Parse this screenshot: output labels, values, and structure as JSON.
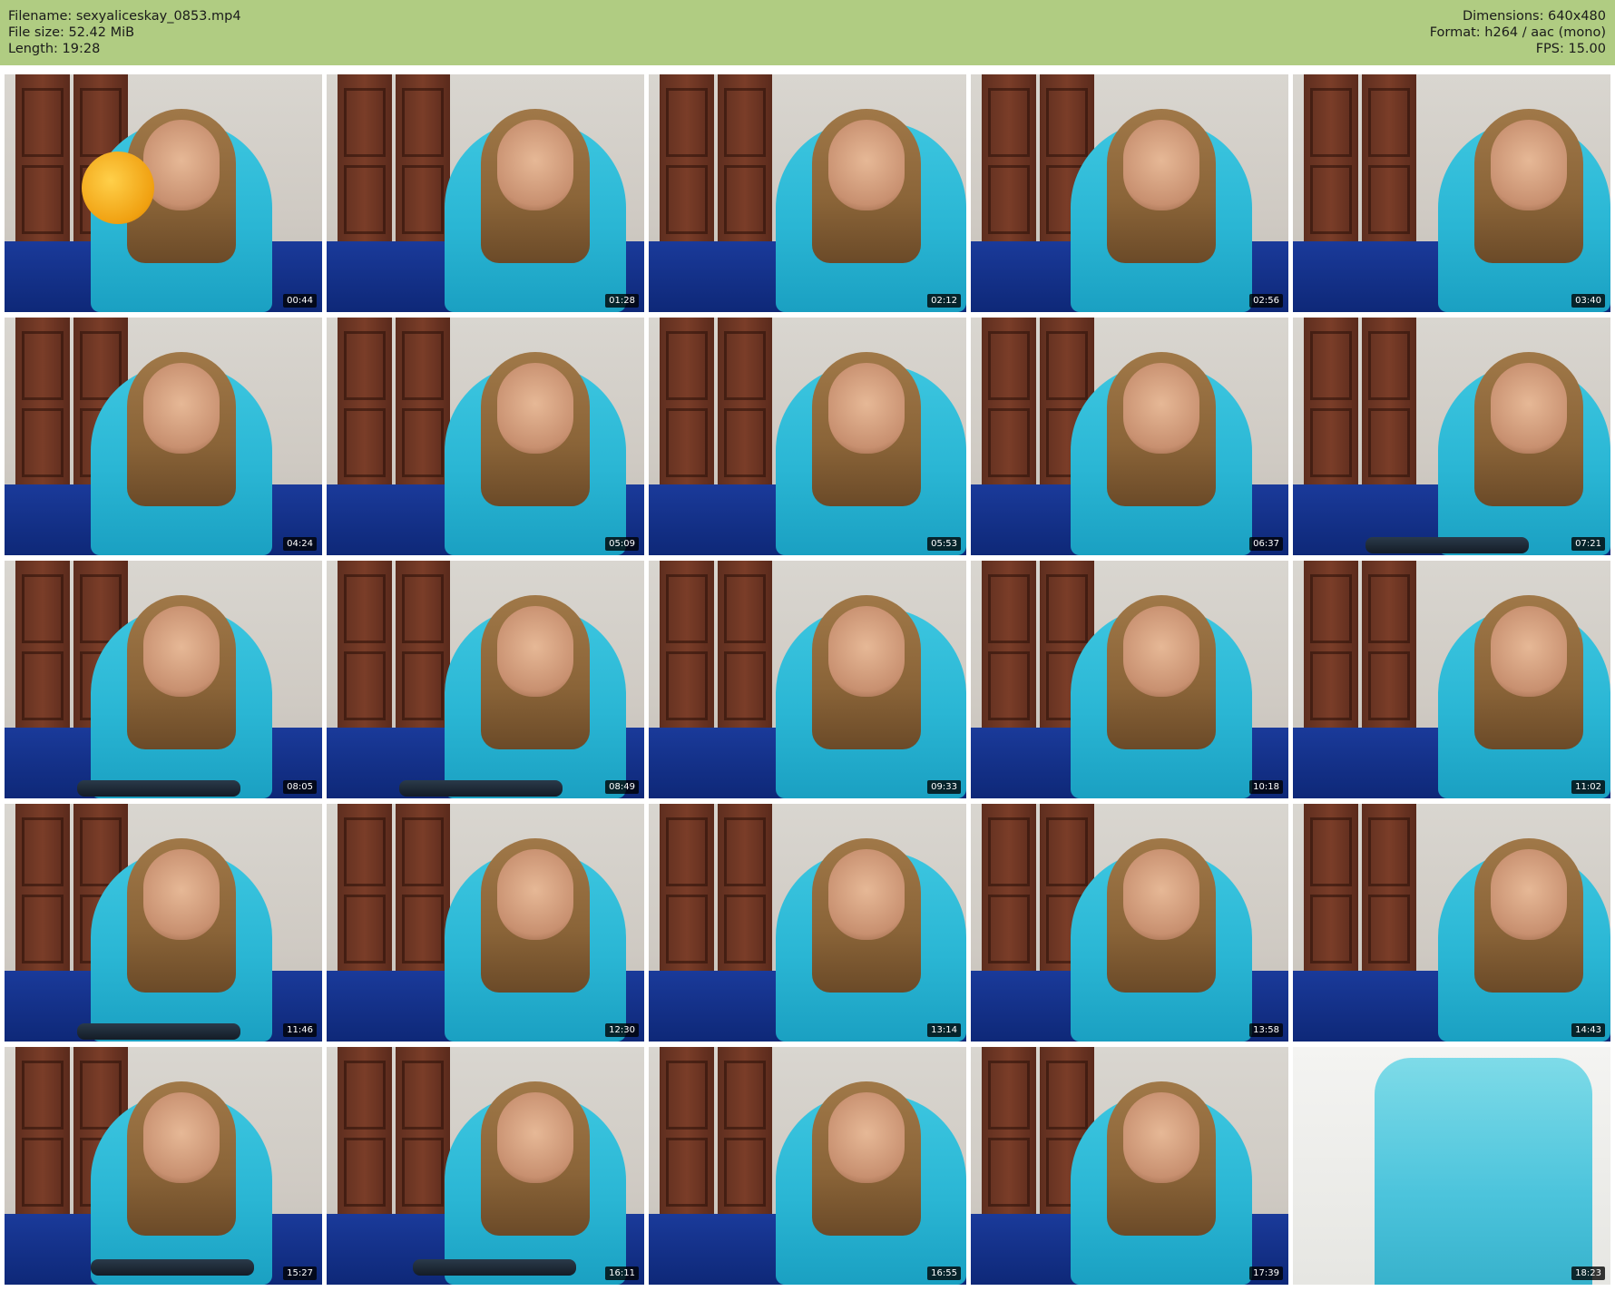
{
  "header": {
    "filename": "Filename: sexyaliceskay_0853.mp4",
    "file_size": "File size: 52.42 MiB",
    "length": "Length: 19:28",
    "dimensions": "Dimensions: 640x480",
    "format": "Format: h264 / aac (mono)",
    "fps": "FPS: 15.00",
    "background_color": "#b0cc82"
  },
  "thumbnails": [
    {
      "timestamp": "00:44"
    },
    {
      "timestamp": "01:28"
    },
    {
      "timestamp": "02:12"
    },
    {
      "timestamp": "02:56"
    },
    {
      "timestamp": "03:40"
    },
    {
      "timestamp": "04:24"
    },
    {
      "timestamp": "05:09"
    },
    {
      "timestamp": "05:53"
    },
    {
      "timestamp": "06:37"
    },
    {
      "timestamp": "07:21"
    },
    {
      "timestamp": "08:05"
    },
    {
      "timestamp": "08:49"
    },
    {
      "timestamp": "09:33"
    },
    {
      "timestamp": "10:18"
    },
    {
      "timestamp": "11:02"
    },
    {
      "timestamp": "11:46"
    },
    {
      "timestamp": "12:30"
    },
    {
      "timestamp": "13:14"
    },
    {
      "timestamp": "13:58"
    },
    {
      "timestamp": "14:43"
    },
    {
      "timestamp": "15:27"
    },
    {
      "timestamp": "16:11"
    },
    {
      "timestamp": "16:55"
    },
    {
      "timestamp": "17:39"
    },
    {
      "timestamp": "18:23"
    }
  ]
}
